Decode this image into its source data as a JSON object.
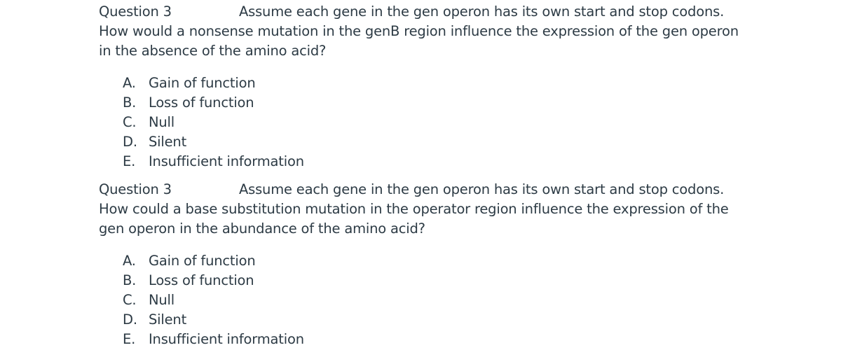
{
  "questions": [
    {
      "number_label": "Question 3",
      "preamble": "Assume each gene in the gen operon has its own start and stop codons.",
      "prompt_line1": "How would a nonsense mutation in the genB region influence the expression of the gen operon",
      "prompt_line2": "in the absence of the amino acid?",
      "options": [
        {
          "letter": "A.",
          "text": "Gain of function"
        },
        {
          "letter": "B.",
          "text": "Loss of function"
        },
        {
          "letter": "C.",
          "text": "Null"
        },
        {
          "letter": "D.",
          "text": "Silent"
        },
        {
          "letter": "E.",
          "text": "Insufficient information"
        }
      ]
    },
    {
      "number_label": "Question 3",
      "preamble": "Assume each gene in the gen operon has its own start and stop codons.",
      "prompt_line1": "How could a base substitution mutation in the operator region influence the expression of the",
      "prompt_line2": "gen operon in the abundance of the amino acid?",
      "options": [
        {
          "letter": "A.",
          "text": "Gain of function"
        },
        {
          "letter": "B.",
          "text": "Loss of function"
        },
        {
          "letter": "C.",
          "text": "Null"
        },
        {
          "letter": "D.",
          "text": "Silent"
        },
        {
          "letter": "E.",
          "text": "Insufficient information"
        }
      ]
    }
  ]
}
